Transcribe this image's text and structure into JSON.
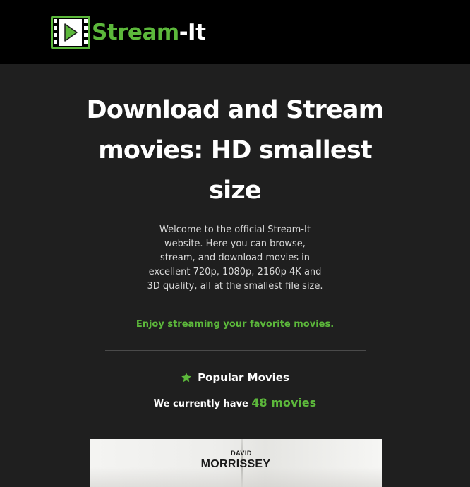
{
  "header": {
    "logo_word_1": "Stream",
    "logo_word_2": "-It",
    "logo_icon": "film-play-icon"
  },
  "hero": {
    "title": "Download and Stream movies: HD smallest size",
    "intro": "Welcome to the official Stream-It website. Here you can browse, stream, and download movies in excellent 720p, 1080p, 2160p 4K and 3D quality, all at the smallest file size.",
    "tagline": "Enjoy streaming your favorite movies."
  },
  "popular": {
    "icon": "star-icon",
    "heading": "Popular Movies",
    "count_prefix": "We currently have",
    "count_value": "48 movies"
  },
  "poster": {
    "name_first": "DAVID",
    "name_last": "MORRISSEY"
  },
  "colors": {
    "accent": "#5cb83b",
    "header_bg": "#000000",
    "page_bg": "#1f1f1f",
    "text": "#ffffff"
  }
}
